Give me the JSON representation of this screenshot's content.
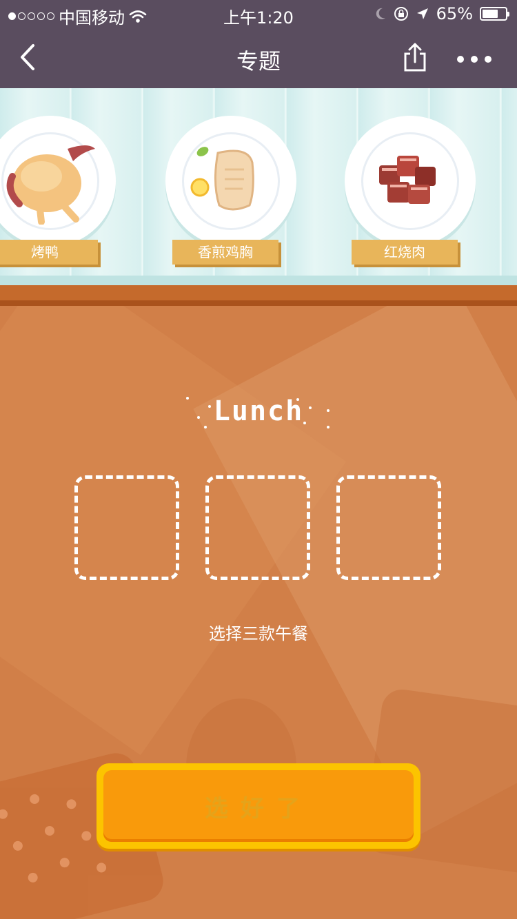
{
  "status_bar": {
    "carrier": "中国移动",
    "time": "上午1:20",
    "battery": "65%",
    "battery_level": 0.65,
    "signal_dots_filled": 1,
    "signal_dots_total": 5
  },
  "nav": {
    "title": "专题",
    "back_icon": "chevron-left-icon",
    "share_icon": "share-icon",
    "more_icon": "more-dots-icon"
  },
  "foods": [
    {
      "label": "烤鸭",
      "icon": "roast-duck-icon"
    },
    {
      "label": "香煎鸡胸",
      "icon": "chicken-breast-icon"
    },
    {
      "label": "红烧肉",
      "icon": "braised-pork-icon"
    }
  ],
  "main": {
    "heading": "Lunch",
    "slot_count": 3,
    "hint": "选择三款午餐",
    "confirm_label": "选好了"
  },
  "colors": {
    "header": "#5a4d5f",
    "orange_bg": "#d17f48",
    "label_gold": "#e8b55a",
    "button_yellow": "#fcc400",
    "button_orange": "#f99a0b"
  }
}
